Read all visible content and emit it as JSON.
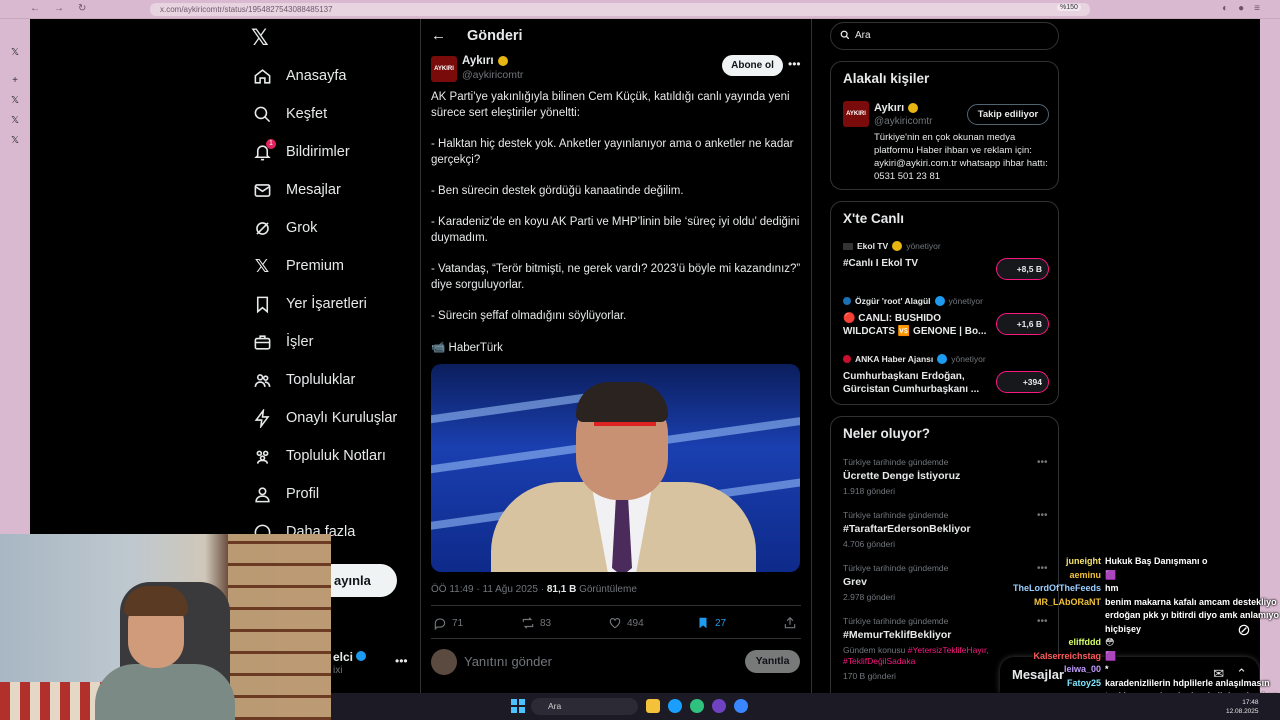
{
  "browser": {
    "url": "x.com/aykiricomtr/status/1954827543088485137",
    "zoom": "%150"
  },
  "nav": {
    "items": [
      {
        "label": "Anasayfa"
      },
      {
        "label": "Keşfet"
      },
      {
        "label": "Bildirimler"
      },
      {
        "label": "Mesajlar"
      },
      {
        "label": "Grok"
      },
      {
        "label": "Premium"
      },
      {
        "label": "Yer İşaretleri"
      },
      {
        "label": "İşler"
      },
      {
        "label": "Topluluklar"
      },
      {
        "label": "Onaylı Kuruluşlar"
      },
      {
        "label": "Topluluk Notları"
      },
      {
        "label": "Profil"
      },
      {
        "label": "Daha fazla"
      }
    ],
    "notification_count": "1",
    "post_button": "ayınla",
    "account_name": "elci",
    "account_handle": "ixi"
  },
  "main": {
    "header_title": "Gönderi",
    "author": {
      "name": "Aykırı",
      "handle": "@aykiricomtr",
      "avatar_text": "AYKIRI"
    },
    "subscribe_label": "Abone ol",
    "text": {
      "p1": "AK Parti’ye yakınlığıyla bilinen Cem Küçük, katıldığı canlı yayında yeni sürece sert eleştiriler yöneltti:",
      "p2": "- Halktan hiç destek yok. Anketler yayınlanıyor ama o anketler ne kadar gerçekçi?",
      "p3": "- Ben sürecin destek gördüğü kanaatinde değilim.",
      "p4": "- Karadeniz’de en koyu AK Parti ve MHP’linin bile ‘süreç iyi oldu’ dediğini duymadım.",
      "p5": "-  Vatandaş, “Terör bitmişti, ne gerek vardı? 2023’ü böyle mi kazandınız?” diye sorguluyorlar.",
      "p6": "- Sürecin şeffaf olmadığını söylüyorlar.",
      "p7": "📹 HaberTürk"
    },
    "meta": {
      "time": "ÖÖ 11:49 · 11 Ağu 2025 · ",
      "views": "81,1 B",
      "views_label": " Görüntüleme"
    },
    "actions": {
      "replies": "71",
      "reposts": "83",
      "likes": "494",
      "bookmarks": "27"
    },
    "reply_placeholder": "Yanıtını gönder",
    "reply_button": "Yanıtla"
  },
  "right": {
    "search_placeholder": "Ara",
    "related": {
      "title": "Alakalı kişiler",
      "name": "Aykırı",
      "handle": "@aykiricomtr",
      "avatar_text": "AYKIRI",
      "follow_label": "Takip ediliyor",
      "bio": "Türkiye'nin en çok okunan medya platformu Haber ihbarı ve reklam için: aykiri@aykiri.com.tr whatsapp ihbar hattı: 0531 501 23 81"
    },
    "live": {
      "title": "X'te Canlı",
      "items": [
        {
          "source": "Ekol TV",
          "status": "yönetiyor",
          "title": "#Canlı I Ekol TV",
          "count": "+8,5 B"
        },
        {
          "source": "Özgür 'root' Alagül",
          "status": "yönetiyor",
          "title": "🔴 CANLI: BUSHIDO WILDCATS 🆚 GENONE | Bo...",
          "count": "+1,6 B"
        },
        {
          "source": "ANKA Haber Ajansı",
          "status": "yönetiyor",
          "title": "Cumhurbaşkanı Erdoğan, Gürcistan Cumhurbaşkanı ...",
          "count": "+394"
        }
      ]
    },
    "trends": {
      "title": "Neler oluyor?",
      "items": [
        {
          "context": "Türkiye tarihinde gündemde",
          "name": "Ücrette Denge İstiyoruz",
          "count": "1.918 gönderi"
        },
        {
          "context": "Türkiye tarihinde gündemde",
          "name": "#TaraftarEdersonBekliyor",
          "count": "4.706 gönderi"
        },
        {
          "context": "Türkiye tarihinde gündemde",
          "name": "Grev",
          "count": "2.978 gönderi"
        },
        {
          "context": "Türkiye tarihinde gündemde",
          "name": "#MemurTeklifBekliyor",
          "topic_prefix": "Gündem konusu ",
          "topic_links": "#YetersizTeklifeHayır, #TeklifDeğilSadaka",
          "count": "170 B gönderi"
        }
      ]
    },
    "messages_title": "Mesajlar"
  },
  "chat": [
    {
      "user": "juneight",
      "msg": "Hukuk Baş Danışmanı o",
      "color": "c-yellow"
    },
    {
      "user": "aeminu",
      "msg": "🟪",
      "color": "c-gold"
    },
    {
      "user": "TheLordOfTheFeeds",
      "msg": "hm",
      "color": "c-blue"
    },
    {
      "user": "MR_LAbORaNT",
      "msg": "benim makarna kafalı amcam destekliyo erdoğan pkk yı bitirdi diyo amk anlamıyo hiçbişey",
      "color": "c-gold"
    },
    {
      "user": "eliffddd",
      "msg": "😳",
      "color": "c-lime"
    },
    {
      "user": "Kalserreichstag",
      "msg": "🟪",
      "color": "c-red"
    },
    {
      "user": "leiwa_00",
      "msg": "*",
      "color": "c-purple"
    },
    {
      "user": "Fatoy25",
      "msg": "karadenizlilerin hdplilerle anlaşılmasın tepki vermesi ne kadar da ilginç demi aq dfgdfg",
      "color": "c-cyan"
    }
  ],
  "taskbar": {
    "search": "Ara",
    "time": "17:48",
    "date": "12.08.2025"
  }
}
